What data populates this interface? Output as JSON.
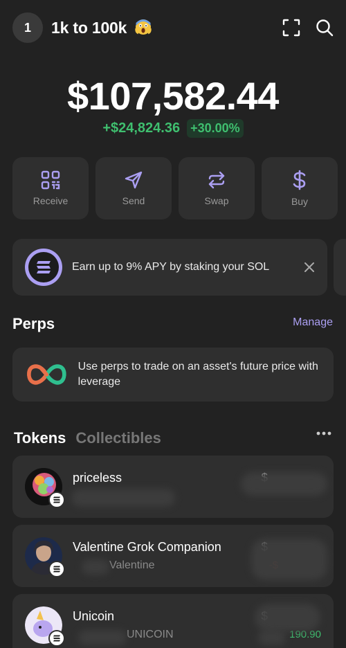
{
  "header": {
    "avatar_text": "1",
    "account_name": "1k to 100k",
    "icons": [
      "scan-icon",
      "search-icon"
    ]
  },
  "balance": {
    "total": "$107,582.44",
    "change_amount": "+$24,824.36",
    "change_percent": "+30.00%"
  },
  "actions": [
    {
      "label": "Receive",
      "icon": "qr-code-icon"
    },
    {
      "label": "Send",
      "icon": "send-arrow-icon"
    },
    {
      "label": "Swap",
      "icon": "swap-icon"
    },
    {
      "label": "Buy",
      "icon": "dollar-icon"
    }
  ],
  "banner": {
    "text": "Earn up to 9% APY by staking your SOL",
    "icon": "solana-icon"
  },
  "perps": {
    "title": "Perps",
    "manage_label": "Manage",
    "text": "Use perps to trade on an asset's future price with leverage"
  },
  "tabs": {
    "active": "Tokens",
    "inactive": "Collectibles"
  },
  "tokens": [
    {
      "name": "priceless",
      "sub": "",
      "value": "$",
      "change": ""
    },
    {
      "name": "Valentine Grok Companion",
      "sub": "Valentine",
      "value": "$",
      "change": "-$"
    },
    {
      "name": "Unicoin",
      "sub": "UNICOIN",
      "value": "$",
      "change": "190.90"
    }
  ],
  "colors": {
    "background": "#222222",
    "card": "#2f2f2f",
    "accent": "#ab9ff2",
    "positive": "#3fbf6f",
    "negative": "#e5533d"
  }
}
